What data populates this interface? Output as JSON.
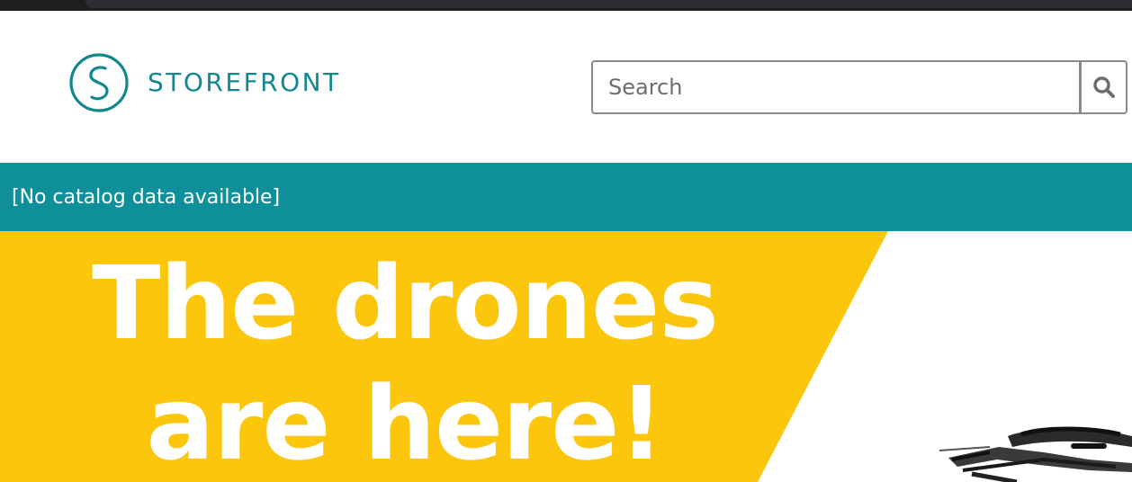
{
  "colors": {
    "brand": "#11878f",
    "nav_bg": "#0f8f9a",
    "hero_yellow": "#fcc60d"
  },
  "header": {
    "logo_text": "STOREFRONT",
    "logo_icon": "storefront-logo-icon"
  },
  "search": {
    "placeholder": "Search",
    "value": "",
    "button_icon": "search-icon"
  },
  "nav": {
    "message": "[No catalog data available]"
  },
  "hero": {
    "heading_line1": "The drones",
    "heading_line2": "are here!",
    "image": "drone-image"
  }
}
